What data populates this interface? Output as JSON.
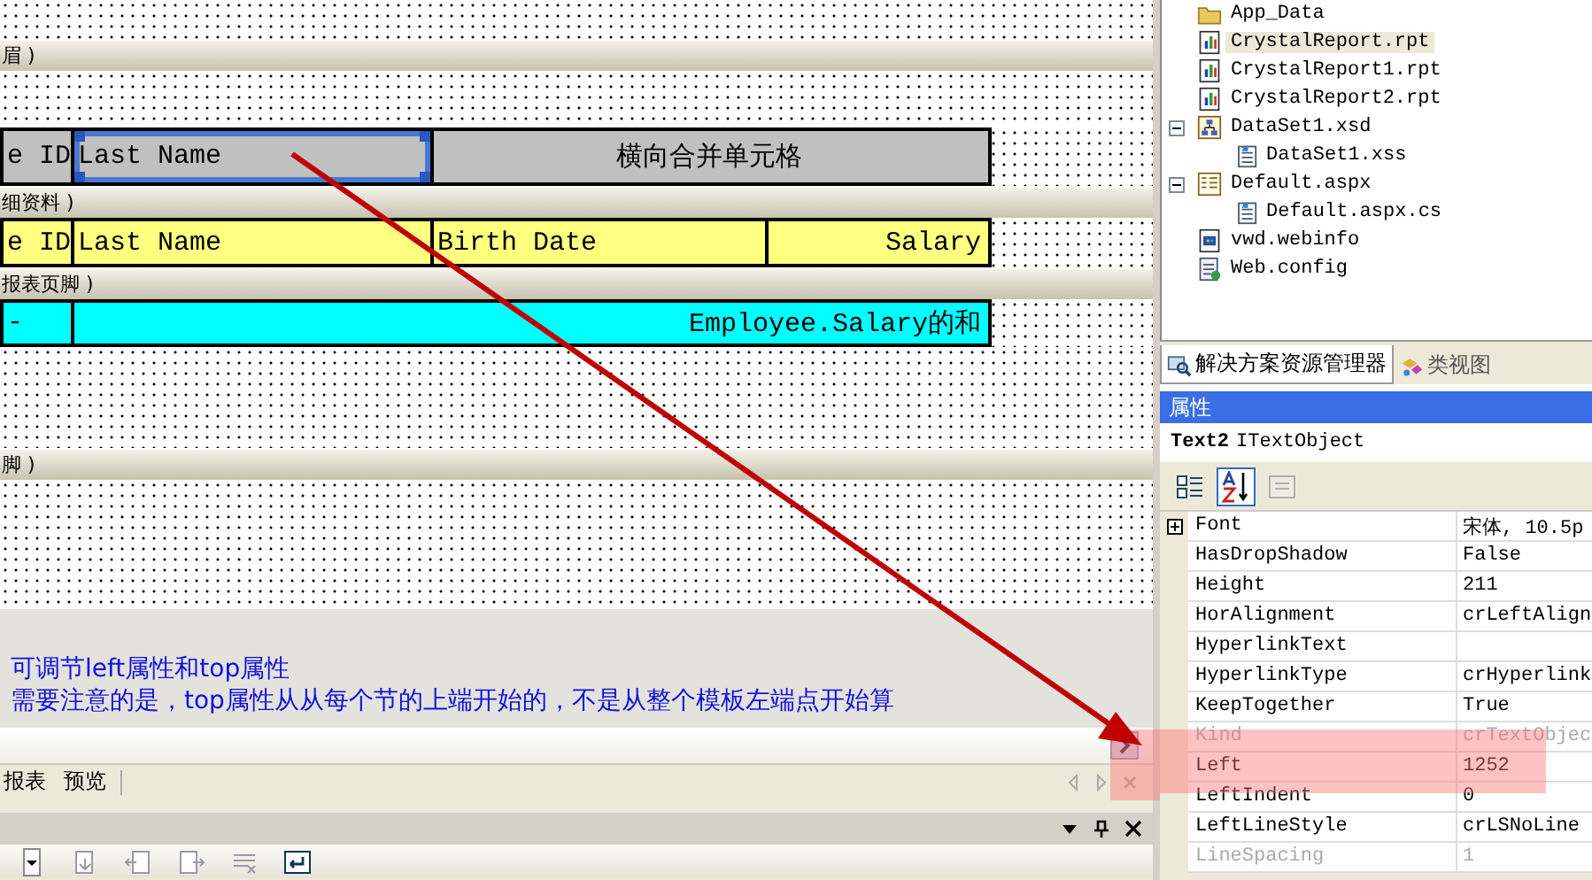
{
  "report": {
    "bands": [
      "眉 )",
      "细资料 )",
      "报表页脚 )",
      "脚 )"
    ],
    "header_section": {
      "color": "#c0c0c0",
      "fields": [
        {
          "text": "e ID",
          "selected": false
        },
        {
          "text": "Last Name",
          "selected": true
        },
        {
          "text": "横向合并单元格",
          "selected": false
        }
      ]
    },
    "detail_section": {
      "color": "#ffff80",
      "fields": [
        {
          "text": "e ID",
          "selected": false
        },
        {
          "text": "Last Name",
          "selected": false
        },
        {
          "text": "Birth Date",
          "selected": false
        },
        {
          "text": "Salary",
          "selected": false
        }
      ]
    },
    "footer_section": {
      "color": "#00ffff",
      "fields": [
        {
          "text": "-",
          "selected": false
        },
        {
          "text": "Employee.Salary的和",
          "selected": false
        }
      ]
    }
  },
  "notes": [
    "可调节left属性和top属性",
    "需要注意的是，top属性从从每个节的上端开始的，不是从整个模板左端点开始算"
  ],
  "editor_tabs": [
    "报表",
    "预览"
  ],
  "solution_explorer": {
    "items": [
      {
        "label": "App_Data",
        "kind": "folder",
        "selected": false
      },
      {
        "label": "CrystalReport.rpt",
        "kind": "report",
        "selected": true
      },
      {
        "label": "CrystalReport1.rpt",
        "kind": "report",
        "selected": false
      },
      {
        "label": "CrystalReport2.rpt",
        "kind": "report",
        "selected": false
      },
      {
        "label": "DataSet1.xsd",
        "kind": "dataset",
        "selected": false,
        "expanded": true,
        "children": [
          {
            "label": "DataSet1.xss",
            "kind": "code",
            "selected": false
          }
        ]
      },
      {
        "label": "Default.aspx",
        "kind": "page",
        "selected": false,
        "expanded": true,
        "children": [
          {
            "label": "Default.aspx.cs",
            "kind": "code",
            "selected": false
          }
        ]
      },
      {
        "label": "vwd.webinfo",
        "kind": "webinfo",
        "selected": false
      },
      {
        "label": "Web.config",
        "kind": "config",
        "selected": false
      }
    ],
    "tabs": [
      {
        "label": "解决方案资源管理器",
        "kind": "explorer",
        "selected": true
      },
      {
        "label": "类视图",
        "kind": "classes",
        "selected": false
      }
    ]
  },
  "properties": {
    "title": "属性",
    "object_name": "Text2",
    "object_type": "ITextObject",
    "toolbar": [
      {
        "kind": "categorized",
        "selected": false,
        "disabled": false
      },
      {
        "kind": "alphabetical",
        "selected": true,
        "disabled": false
      },
      {
        "kind": "pages",
        "selected": false,
        "disabled": true
      }
    ],
    "rows": [
      {
        "name": "Font",
        "value": "宋体, 10.5p",
        "kind": "group",
        "disabled": false
      },
      {
        "name": "HasDropShadow",
        "value": "False",
        "kind": "plain",
        "disabled": false
      },
      {
        "name": "Height",
        "value": "211",
        "kind": "plain",
        "disabled": false
      },
      {
        "name": "HorAlignment",
        "value": "crLeftAlign",
        "kind": "plain",
        "disabled": false
      },
      {
        "name": "HyperlinkText",
        "kind": "plain",
        "disabled": false
      },
      {
        "name": "HyperlinkType",
        "value": "crHyperlink",
        "kind": "plain",
        "disabled": false
      },
      {
        "name": "KeepTogether",
        "value": "True",
        "kind": "plain",
        "disabled": false
      },
      {
        "name": "Kind",
        "value": "crTextObjec",
        "kind": "plain",
        "disabled": true
      },
      {
        "name": "Left",
        "value": "1252",
        "kind": "plain",
        "disabled": false
      },
      {
        "name": "LeftIndent",
        "value": "0",
        "kind": "plain",
        "disabled": false
      },
      {
        "name": "LeftLineStyle",
        "value": "crLSNoLine",
        "kind": "plain",
        "disabled": false
      },
      {
        "name": "LineSpacing",
        "value": "1",
        "kind": "plain",
        "disabled": true
      }
    ]
  }
}
